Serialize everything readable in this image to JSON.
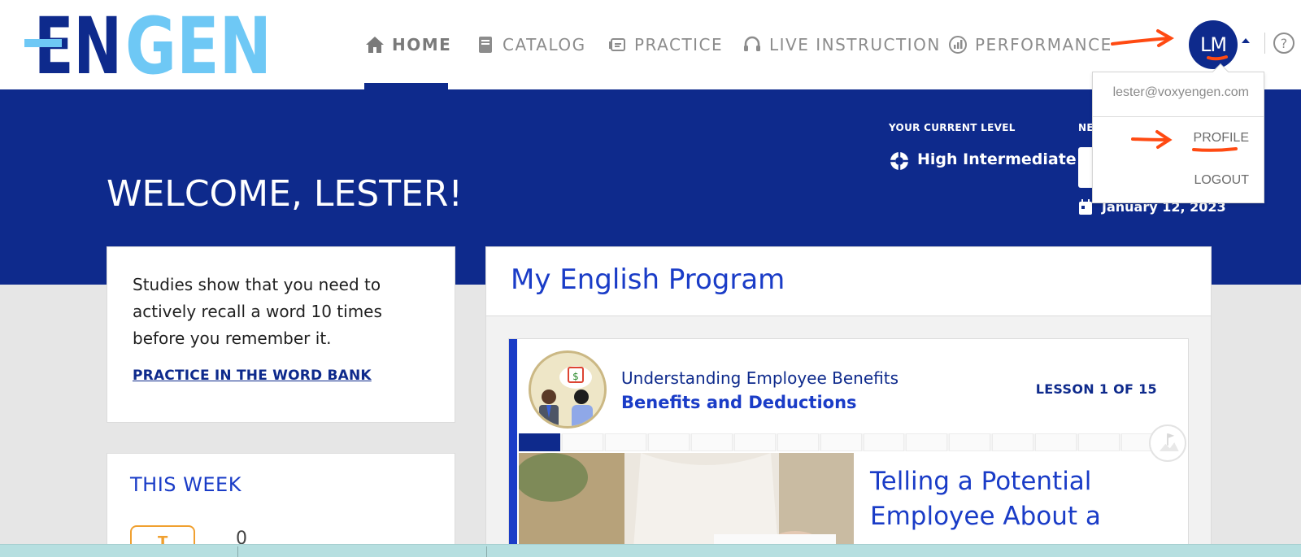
{
  "brand": {
    "logo_text": "ENGEN",
    "dark": "#0e2a8c",
    "light": "#6ec8f5"
  },
  "nav": {
    "home": "HOME",
    "catalog": "CATALOG",
    "practice": "PRACTICE",
    "live_instruction": "LIVE INSTRUCTION",
    "performance": "PERFORMANCE"
  },
  "user": {
    "initials": "LM",
    "email": "lester@voxyengen.com"
  },
  "menu": {
    "profile": "PROFILE",
    "logout": "LOGOUT"
  },
  "help_glyph": "?",
  "banner": {
    "welcome": "WELCOME, LESTER!",
    "level_label": "YOUR CURRENT LEVEL",
    "level_value": "High Intermediate",
    "next_label": "NE",
    "date": "January 12, 2023"
  },
  "tip": {
    "text": "Studies show that you need to actively recall a word 10 times before you remember it.",
    "link": "PRACTICE IN THE WORD BANK"
  },
  "week": {
    "title": "THIS WEEK",
    "day_letter": "T",
    "count": "0"
  },
  "program": {
    "title": "My English Program",
    "course": "Understanding Employee Benefits",
    "lesson": "Benefits and Deductions",
    "lesson_count": "LESSON 1 OF 15",
    "progress_completed": 1,
    "progress_total": 15,
    "activity_title": "Telling a Potential Employee About a"
  },
  "colors": {
    "accent": "#1a3cc7",
    "navy": "#0e2a8c",
    "annotation": "#ff4a12"
  }
}
